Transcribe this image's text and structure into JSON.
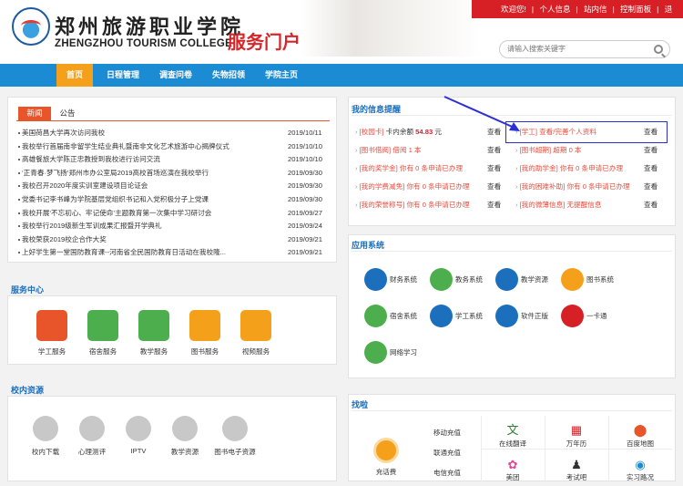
{
  "header": {
    "logo_cn": "郑州旅游职业学院",
    "logo_en": "ZHENGZHOU TOURISM COLLEGE",
    "portal_title": "服务门户",
    "welcome": "欢迎您!",
    "user_links": [
      "个人信息",
      "站内信",
      "控制面板",
      "退出"
    ],
    "search_placeholder": "请输入搜索关键字"
  },
  "nav": [
    "首页",
    "日程管理",
    "调查问卷",
    "失物招领",
    "学院主页"
  ],
  "news": {
    "tabs": [
      "新闻",
      "公告"
    ],
    "items": [
      {
        "title": "美国荷昌大学再次访问我校",
        "date": "2019/10/11"
      },
      {
        "title": "我校举行首届南非留学生结业典礼暨南非文化艺术旅游中心揭牌仪式",
        "date": "2019/10/10"
      },
      {
        "title": "高雄餐旅大学陈正忠教授到我校进行访问交流",
        "date": "2019/10/10"
      },
      {
        "title": "‘正青春·梦飞扬’郑州市办公室局2019高校首场巡演在我校举行",
        "date": "2019/09/30"
      },
      {
        "title": "我校召开2020年度实训室建设项目论证会",
        "date": "2019/09/30"
      },
      {
        "title": "党委书记李书峰为学院基层党组织书记和入党积极分子上党课",
        "date": "2019/09/30"
      },
      {
        "title": "我校开展‘不忘初心、牢记使命’主题教育第一次集中学习研讨会",
        "date": "2019/09/27"
      },
      {
        "title": "我校举行2019级新生军训成果汇报暨开学典礼",
        "date": "2019/09/24"
      },
      {
        "title": "我校荣获2019校企合作大奖",
        "date": "2019/09/21"
      },
      {
        "title": "上好学生第一堂国防教育课--河南省全民国防教育日活动在我校隆...",
        "date": "2019/09/21"
      }
    ]
  },
  "service_center": {
    "title": "服务中心",
    "items": [
      "学工服务",
      "宿舍服务",
      "教学服务",
      "图书服务",
      "视频服务"
    ]
  },
  "campus_resources": {
    "title": "校内资源",
    "items": [
      "校内下载",
      "心理测评",
      "IPTV",
      "教学资源",
      "图书电子资源"
    ]
  },
  "my_info": {
    "title": "我的信息提醒",
    "look": "查看",
    "left": [
      {
        "tag": "[校园卡]",
        "text": "卡内余额",
        "amount": "54.83",
        "unit": "元"
      },
      {
        "tag": "[图书借阅]",
        "text": "借阅 1 本"
      },
      {
        "tag": "[我的奖学金]",
        "text": "你有 0 条申请已办理"
      },
      {
        "tag": "[我的学费减免]",
        "text": "你有 0 条申请已办理"
      },
      {
        "tag": "[我的荣誉称号]",
        "text": "你有 0 条申请已办理"
      }
    ],
    "right": [
      {
        "tag": "[学工]",
        "text": "查看/完善个人资料"
      },
      {
        "tag": "[图书超期]",
        "text": "超期 0 本"
      },
      {
        "tag": "[我的助学金]",
        "text": "你有 0 条申请已办理"
      },
      {
        "tag": "[我的困难补助]",
        "text": "你有 0 条申请已办理"
      },
      {
        "tag": "[我的微薄信息]",
        "text": "无提醒信息"
      }
    ]
  },
  "apps": {
    "title": "应用系统",
    "items": [
      "财务系统",
      "教务系统",
      "教学资源",
      "图书系统",
      "宿舍系统",
      "学工系统",
      "软件正版",
      "一卡通",
      "网络学习"
    ]
  },
  "tools": {
    "title": "找啦",
    "recharge": "充话费",
    "recharge_opts": [
      "移动充值",
      "联通充值",
      "电信充值"
    ],
    "items": [
      "在线翻译",
      "万年历",
      "百度地图",
      "美团",
      "考试吧",
      "实习路况"
    ]
  },
  "colors": {
    "nav_blue": "#1b8bd3",
    "nav_active": "#f5a01a",
    "brand_red": "#d71f26",
    "title_blue": "#1b6fbd"
  }
}
